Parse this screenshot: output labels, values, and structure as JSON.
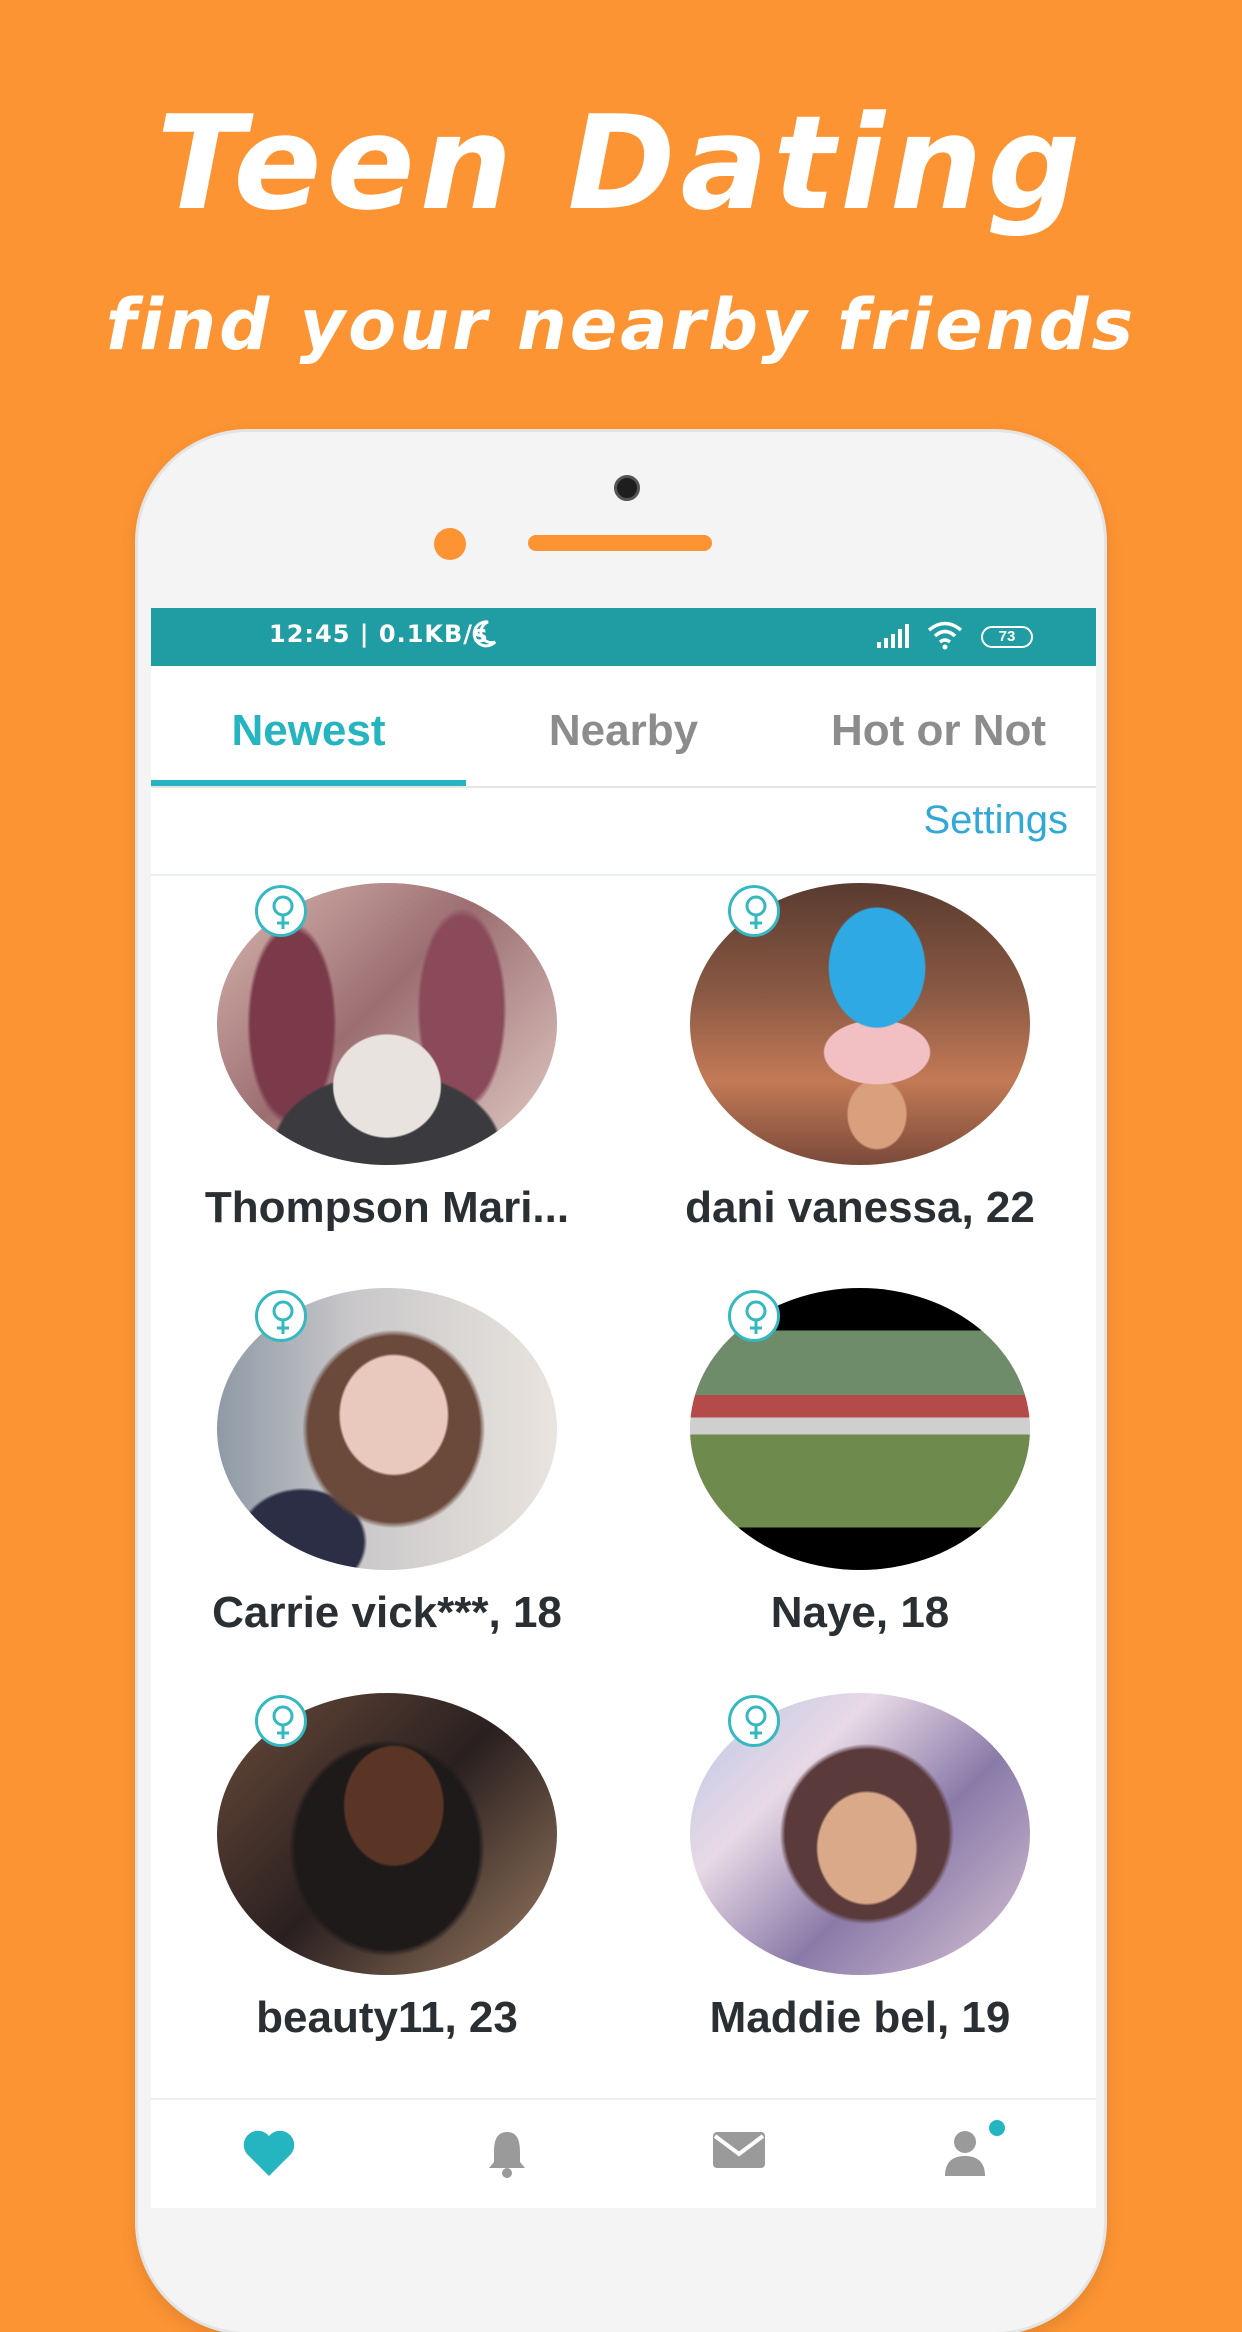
{
  "promo": {
    "headline": "Teen Dating",
    "subline": "find your nearby friends"
  },
  "status_bar": {
    "time": "12:45 | 0.1KB/s",
    "battery": "73"
  },
  "tabs": [
    {
      "label": "Newest",
      "active": true
    },
    {
      "label": "Nearby",
      "active": false
    },
    {
      "label": "Hot or Not",
      "active": false
    }
  ],
  "settings_label": "Settings",
  "profiles": [
    {
      "name": "Thompson Mari...",
      "gender": "female"
    },
    {
      "name": "dani vanessa, 22",
      "gender": "female"
    },
    {
      "name": "Carrie vick***, 18",
      "gender": "female"
    },
    {
      "name": "Naye, 18",
      "gender": "female"
    },
    {
      "name": "beauty11, 23",
      "gender": "female"
    },
    {
      "name": "Maddie bel, 19",
      "gender": "female"
    }
  ],
  "bottom_nav": [
    {
      "icon": "heart-icon",
      "active": true
    },
    {
      "icon": "bell-icon",
      "active": false
    },
    {
      "icon": "mail-icon",
      "active": false
    },
    {
      "icon": "profile-icon",
      "active": false,
      "badge_dot": true
    }
  ],
  "colors": {
    "background_orange": "#FC9433",
    "teal_status": "#1F9DA2",
    "accent": "#25B5C1",
    "link_blue": "#32A8D6"
  }
}
